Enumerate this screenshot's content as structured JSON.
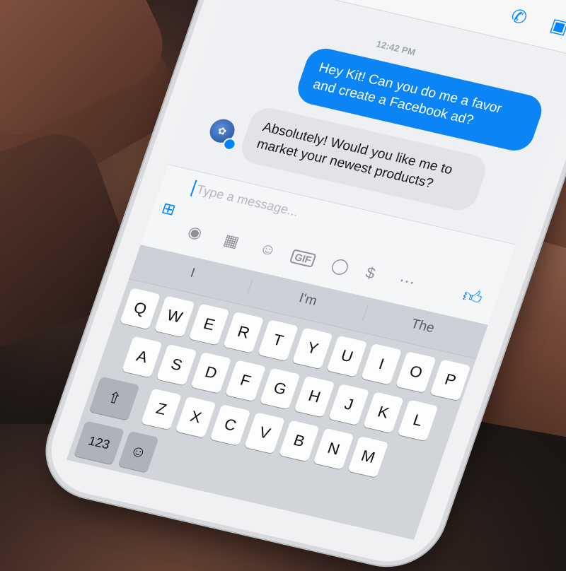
{
  "header": {
    "call_icon": "phone-icon",
    "video_icon": "video-camera-icon"
  },
  "thread": {
    "timestamp": "12:42 PM",
    "messages": [
      {
        "from": "me",
        "text": "Hey Kit! Can you do me a favor and create a Facebook ad?"
      },
      {
        "from": "bot",
        "text": "Absolutely! Would you like me to market your newest products?"
      }
    ]
  },
  "composer": {
    "placeholder": "Type a message...",
    "tools": [
      "camera-icon",
      "image-icon",
      "emoji-icon",
      "gif-icon",
      "microphone-icon",
      "payment-icon",
      "more-icon"
    ],
    "gif_label": "GIF"
  },
  "keyboard": {
    "predictions": [
      "I",
      "I'm",
      "The"
    ],
    "row1": [
      "Q",
      "W",
      "E",
      "R",
      "T",
      "Y",
      "U",
      "I",
      "O",
      "P"
    ],
    "row2": [
      "A",
      "S",
      "D",
      "F",
      "G",
      "H",
      "J",
      "K",
      "L"
    ],
    "row3": [
      "Z",
      "X",
      "C",
      "V",
      "B",
      "N",
      "M"
    ],
    "numbers_label": "123"
  },
  "colors": {
    "accent": "#0084ff",
    "outgoing": "#0b84f5",
    "incoming": "#e2e3e6"
  }
}
